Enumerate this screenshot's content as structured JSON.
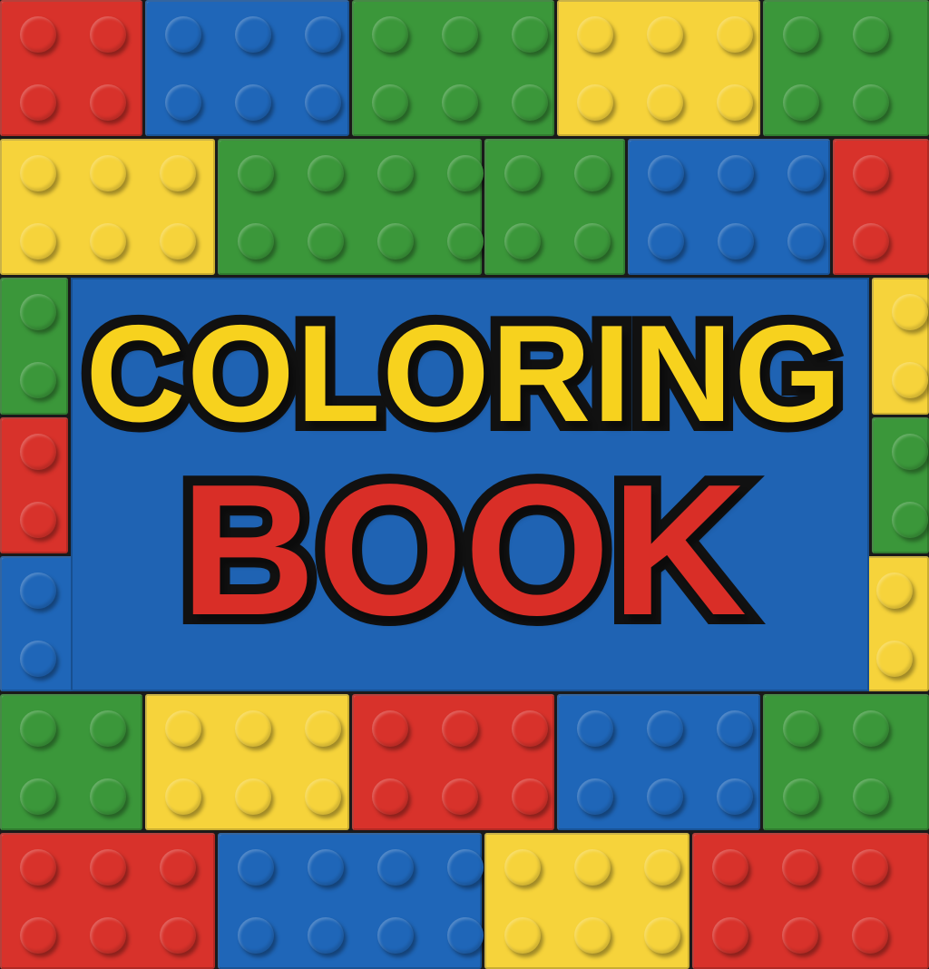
{
  "title": {
    "line1": "COLORING",
    "line2": "BOOK"
  },
  "colors": {
    "red": "#d8322b",
    "blue": "#1f66b8",
    "green": "#3b973a",
    "yellow": "#f6d33b",
    "line1": "#f7d21e",
    "line2": "#d92e27"
  }
}
